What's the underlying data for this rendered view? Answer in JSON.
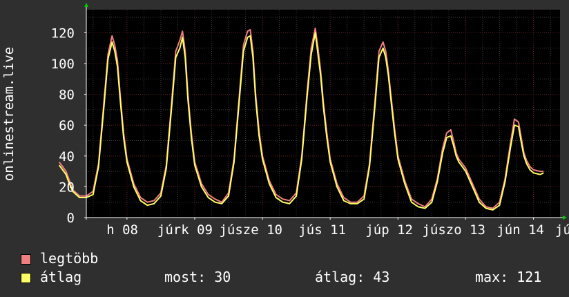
{
  "chart_data": {
    "type": "line",
    "ylabel": "onlinestream.live",
    "ylim": [
      0,
      135
    ],
    "yticks": [
      0,
      20,
      40,
      60,
      80,
      100,
      120
    ],
    "xtick_labels": [
      "h 08",
      "júrk 09",
      "júsze 10",
      "jús 11",
      "júp 12",
      "júszo 13",
      "jún 14",
      "jú"
    ],
    "grid": true,
    "series": [
      {
        "name": "legtöbb",
        "color": "#f08080",
        "x_days": [
          0.0,
          0.05,
          0.1,
          0.15,
          0.2,
          0.3,
          0.4,
          0.5,
          0.58,
          0.66,
          0.72,
          0.78,
          0.82,
          0.86,
          0.9,
          0.95,
          1.0,
          1.1,
          1.2,
          1.3,
          1.4,
          1.5,
          1.58,
          1.66,
          1.72,
          1.78,
          1.82,
          1.86,
          1.9,
          1.95,
          2.0,
          2.1,
          2.2,
          2.3,
          2.4,
          2.5,
          2.58,
          2.66,
          2.72,
          2.78,
          2.82,
          2.86,
          2.9,
          2.95,
          3.0,
          3.1,
          3.2,
          3.3,
          3.4,
          3.5,
          3.58,
          3.66,
          3.72,
          3.78,
          3.82,
          3.86,
          3.9,
          3.95,
          4.0,
          4.1,
          4.2,
          4.3,
          4.4,
          4.5,
          4.58,
          4.66,
          4.72,
          4.78,
          4.82,
          4.86,
          4.9,
          4.95,
          5.0,
          5.1,
          5.2,
          5.3,
          5.4,
          5.5,
          5.58,
          5.66,
          5.72,
          5.78,
          5.82,
          5.86,
          5.9,
          5.95,
          6.0,
          6.1,
          6.2,
          6.3,
          6.4,
          6.5,
          6.58,
          6.66,
          6.72,
          6.78,
          6.82,
          6.86,
          6.9,
          6.95,
          7.0,
          7.1,
          7.15
        ],
        "values": [
          36,
          33,
          30,
          24,
          18,
          14,
          14,
          17,
          35,
          75,
          106,
          118,
          112,
          102,
          80,
          55,
          38,
          22,
          13,
          10,
          11,
          16,
          34,
          75,
          108,
          115,
          121,
          108,
          80,
          55,
          36,
          22,
          15,
          12,
          10,
          16,
          38,
          80,
          112,
          121,
          122,
          108,
          80,
          56,
          40,
          24,
          15,
          12,
          11,
          16,
          40,
          82,
          110,
          123,
          110,
          95,
          75,
          55,
          38,
          22,
          13,
          10,
          10,
          14,
          35,
          75,
          108,
          114,
          108,
          95,
          78,
          58,
          40,
          24,
          12,
          9,
          7,
          12,
          25,
          45,
          55,
          57,
          50,
          42,
          38,
          35,
          32,
          22,
          12,
          7,
          6,
          10,
          25,
          48,
          64,
          62,
          52,
          42,
          37,
          33,
          31,
          30,
          30
        ]
      },
      {
        "name": "átlag",
        "color": "#ffff66",
        "x_days": [
          0.0,
          0.05,
          0.1,
          0.15,
          0.2,
          0.3,
          0.4,
          0.5,
          0.58,
          0.66,
          0.72,
          0.78,
          0.82,
          0.86,
          0.9,
          0.95,
          1.0,
          1.1,
          1.2,
          1.3,
          1.4,
          1.5,
          1.58,
          1.66,
          1.72,
          1.78,
          1.82,
          1.86,
          1.9,
          1.95,
          2.0,
          2.1,
          2.2,
          2.3,
          2.4,
          2.5,
          2.58,
          2.66,
          2.72,
          2.78,
          2.82,
          2.86,
          2.9,
          2.95,
          3.0,
          3.1,
          3.2,
          3.3,
          3.4,
          3.5,
          3.58,
          3.66,
          3.72,
          3.78,
          3.82,
          3.86,
          3.9,
          3.95,
          4.0,
          4.1,
          4.2,
          4.3,
          4.4,
          4.5,
          4.58,
          4.66,
          4.72,
          4.78,
          4.82,
          4.86,
          4.9,
          4.95,
          5.0,
          5.1,
          5.2,
          5.3,
          5.4,
          5.5,
          5.58,
          5.66,
          5.72,
          5.78,
          5.82,
          5.86,
          5.9,
          5.95,
          6.0,
          6.1,
          6.2,
          6.3,
          6.4,
          6.5,
          6.58,
          6.66,
          6.72,
          6.78,
          6.82,
          6.86,
          6.9,
          6.95,
          7.0,
          7.1,
          7.15
        ],
        "values": [
          34,
          31,
          28,
          22,
          17,
          13,
          13,
          15,
          33,
          72,
          103,
          114,
          108,
          98,
          77,
          52,
          36,
          20,
          11,
          8,
          9,
          14,
          32,
          72,
          104,
          110,
          117,
          104,
          77,
          52,
          34,
          20,
          13,
          10,
          9,
          14,
          36,
          77,
          108,
          117,
          118,
          104,
          77,
          53,
          38,
          22,
          13,
          10,
          9,
          14,
          38,
          79,
          106,
          120,
          106,
          92,
          72,
          52,
          36,
          20,
          11,
          9,
          9,
          12,
          33,
          72,
          104,
          110,
          104,
          92,
          75,
          55,
          38,
          22,
          10,
          7,
          6,
          10,
          23,
          42,
          52,
          53,
          47,
          40,
          36,
          33,
          30,
          20,
          10,
          6,
          5,
          8,
          23,
          45,
          60,
          59,
          49,
          40,
          35,
          31,
          29,
          28,
          29
        ]
      }
    ]
  },
  "legend": {
    "max_label": "legtöbb",
    "avg_label": "átlag",
    "max_color": "#f08080",
    "avg_color": "#ffff66"
  },
  "stats": {
    "now": "most: 30",
    "avg": "átlag: 43",
    "max": "max: 121"
  }
}
